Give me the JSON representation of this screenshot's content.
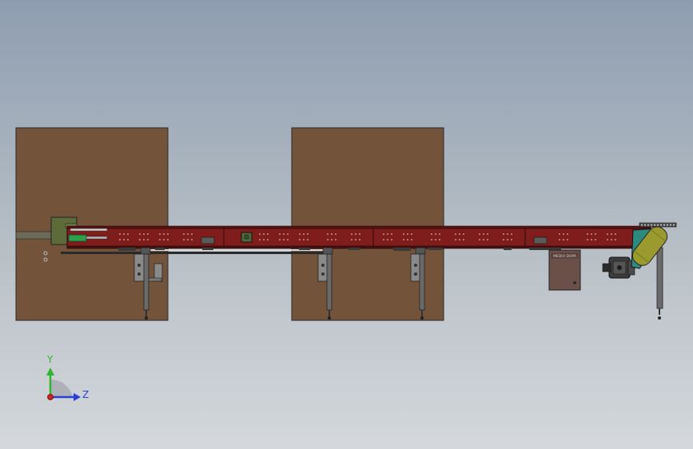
{
  "viewport": {
    "background_top": "#8e9db0",
    "background_bottom": "#d4d8dc"
  },
  "model": {
    "panel_color": "#73543b",
    "conveyor_color": "#7e1d1b",
    "motor_color": "#9a9a2e",
    "gearbox_color": "#2c8a80",
    "drive_box_color": "#5d6a39",
    "control_box_color": "#6b4f49",
    "control_box_label": "MEDIO DOPA"
  },
  "triad": {
    "y_label": "Y",
    "z_label": "Z",
    "y_color": "#2fb52f",
    "z_color": "#2b3fd8",
    "x_color": "#d41d1d"
  }
}
